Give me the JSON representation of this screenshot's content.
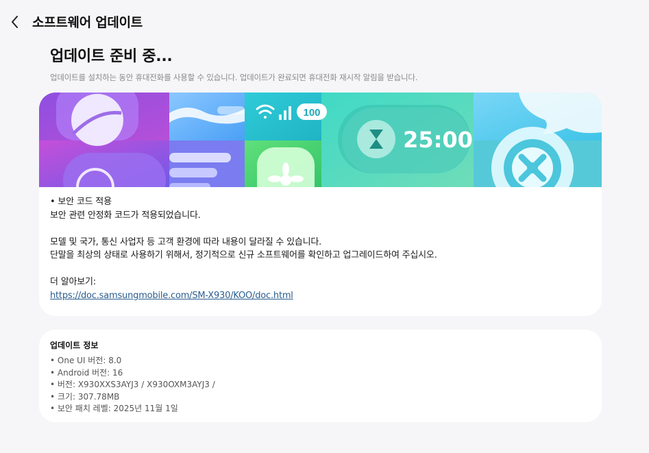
{
  "header": {
    "title": "소프트웨어 업데이트"
  },
  "page": {
    "title": "업데이트 준비 중...",
    "subtitle": "업데이트를 설치하는 동안 휴대전화를 사용할 수 있습니다. 업데이트가 완료되면 휴대전화 재시작 알림을 받습니다."
  },
  "banner": {
    "timer_text": "25:00",
    "battery_text": "100",
    "icons": [
      "planet-icon",
      "wifi-icon",
      "signal-icon",
      "battery-icon",
      "hourglass-icon",
      "gear-icon",
      "flower-icon",
      "chat-bubble-icon"
    ]
  },
  "notes": {
    "line1": "• 보안 코드 적용",
    "line2": "보안 관련 안정화 코드가 적용되었습니다.",
    "line3": "모델 및 국가, 통신 사업자 등 고객 환경에 따라 내용이 달라질 수 있습니다.",
    "line4": "단말을 최상의 상태로 사용하기 위해서, 정기적으로 신규 소프트웨어를 확인하고 업그레이드하여 주십시오.",
    "line5": "더 알아보기:",
    "link": "https://doc.samsungmobile.com/SM-X930/KOO/doc.html"
  },
  "info": {
    "title": "업데이트 정보",
    "items": [
      "• One UI 버전: 8.0",
      "• Android 버전: 16",
      "• 버전: X930XXS3AYJ3 / X930OXM3AYJ3 /",
      "• 크기: 307.78MB",
      "• 보안 패치 레벨: 2025년 11월 1일"
    ]
  },
  "colors": {
    "background": "#f6f6f8",
    "card": "#ffffff",
    "link": "#2a5d8f",
    "muted": "#8a8a8e"
  }
}
